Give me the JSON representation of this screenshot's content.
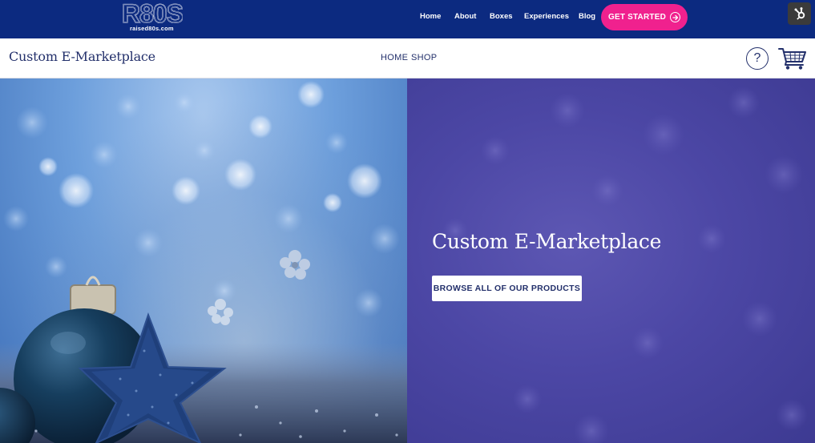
{
  "brand": {
    "logo_text": "R80S",
    "logo_url_text": "raised80s.com",
    "bar_color": "#0c2a80",
    "accent_color": "#f0218e"
  },
  "top_nav": {
    "items": [
      "Home",
      "About",
      "Boxes",
      "Experiences",
      "Blog"
    ],
    "cta_label": "GET STARTED",
    "cta_icon": "arrow-circle-right-icon",
    "badge_icon": "hubspot-sprocket-icon"
  },
  "store_header": {
    "title": "Custom E-Marketplace",
    "nav": [
      "HOME",
      "SHOP"
    ],
    "help_icon": "question-circle-icon",
    "help_glyph": "?",
    "cart_icon": "shopping-cart-icon"
  },
  "hero": {
    "heading": "Custom E-Marketplace",
    "button_label": "BROWSE ALL OF OUR PRODUCTS",
    "image": "christmas-ornaments-bokeh-photo"
  }
}
